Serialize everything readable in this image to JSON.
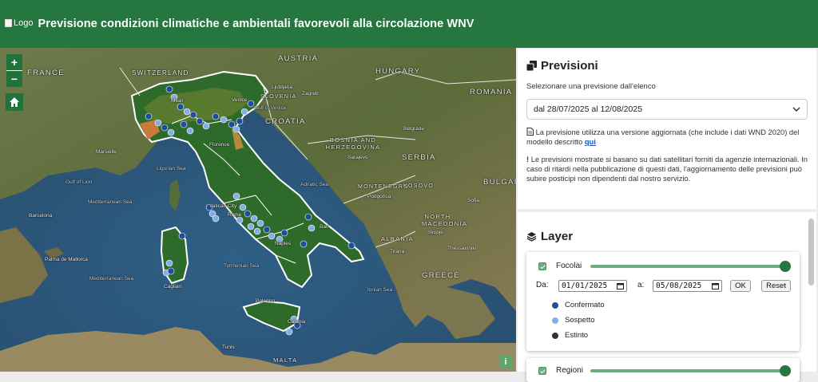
{
  "header": {
    "logo_alt": "Logo",
    "title": "Previsione condizioni climatiche e ambientali favorevoli alla circolazione WNV",
    "bg_color": "#25773f"
  },
  "map": {
    "zoom_in": "+",
    "zoom_out": "−",
    "home_icon": "home-icon",
    "info": "i",
    "countries": [
      "AUSTRIA",
      "HUNGARY",
      "FRANCE",
      "SLOVENIA",
      "CROATIA",
      "ROMANIA",
      "BOSNIA AND HERZEGOVINA",
      "SERBIA",
      "MONTENEGRO",
      "KOSOVO",
      "BULGARIA",
      "NORTH MACEDONIA",
      "ALBANIA",
      "GREECE",
      "SWITZERLAND",
      "MALTA"
    ],
    "seas": [
      "Mediterranean Sea",
      "Mediterranean Sea",
      "Tyrrhenian Sea",
      "Adriatic Sea",
      "Ligurian Sea",
      "Ionian Sea",
      "Gulf of Lion",
      "Gulf of Venice"
    ],
    "cities": [
      "Marseille",
      "Barcelona",
      "Vatican City",
      "Palma de Mallorca",
      "Tunis",
      "Bari",
      "Naples",
      "Rome",
      "Florence",
      "Milan",
      "Venice",
      "Belgrade",
      "Sarajevo",
      "Sofia",
      "Skopje",
      "Tirana",
      "Podgorica",
      "Ljubljana",
      "Zagreb",
      "Thessaloniki",
      "Palermo",
      "Catania",
      "Cagliari"
    ],
    "dot_colors": {
      "confermato": "#1f4d9e",
      "sospetto": "#86aee6"
    }
  },
  "previsioni": {
    "title": "Previsioni",
    "subtitle": "Selezionare una previsione dall'elenco",
    "selected": "dal 28/07/2025 al 12/08/2025",
    "note1_prefix": "La previsione utilizza una versione aggiornata (che include i dati WND 2020) del modello descritto ",
    "note1_link": "qui",
    "note2": "Le previsioni mostrate si basano su dati satellitari forniti da agenzie internazionali. In caso di ritardi nella pubblicazione di questi dati, l'aggiornamento delle previsioni può subire posticipi non dipendenti dal nostro servizio."
  },
  "layer": {
    "title": "Layer",
    "focolai": {
      "label": "Focolai",
      "checked": true,
      "opacity": 1.0,
      "da_label": "Da:",
      "da_value": "01/01/2025",
      "a_label": "a:",
      "a_value": "05/08/2025",
      "ok": "OK",
      "reset": "Reset",
      "legend": [
        {
          "label": "Confermato",
          "color": "#1f4d9e"
        },
        {
          "label": "Sospetto",
          "color": "#86aee6"
        },
        {
          "label": "Estinto",
          "color": "#333333"
        }
      ]
    },
    "regioni": {
      "label": "Regioni",
      "checked": true,
      "opacity": 1.0
    }
  }
}
